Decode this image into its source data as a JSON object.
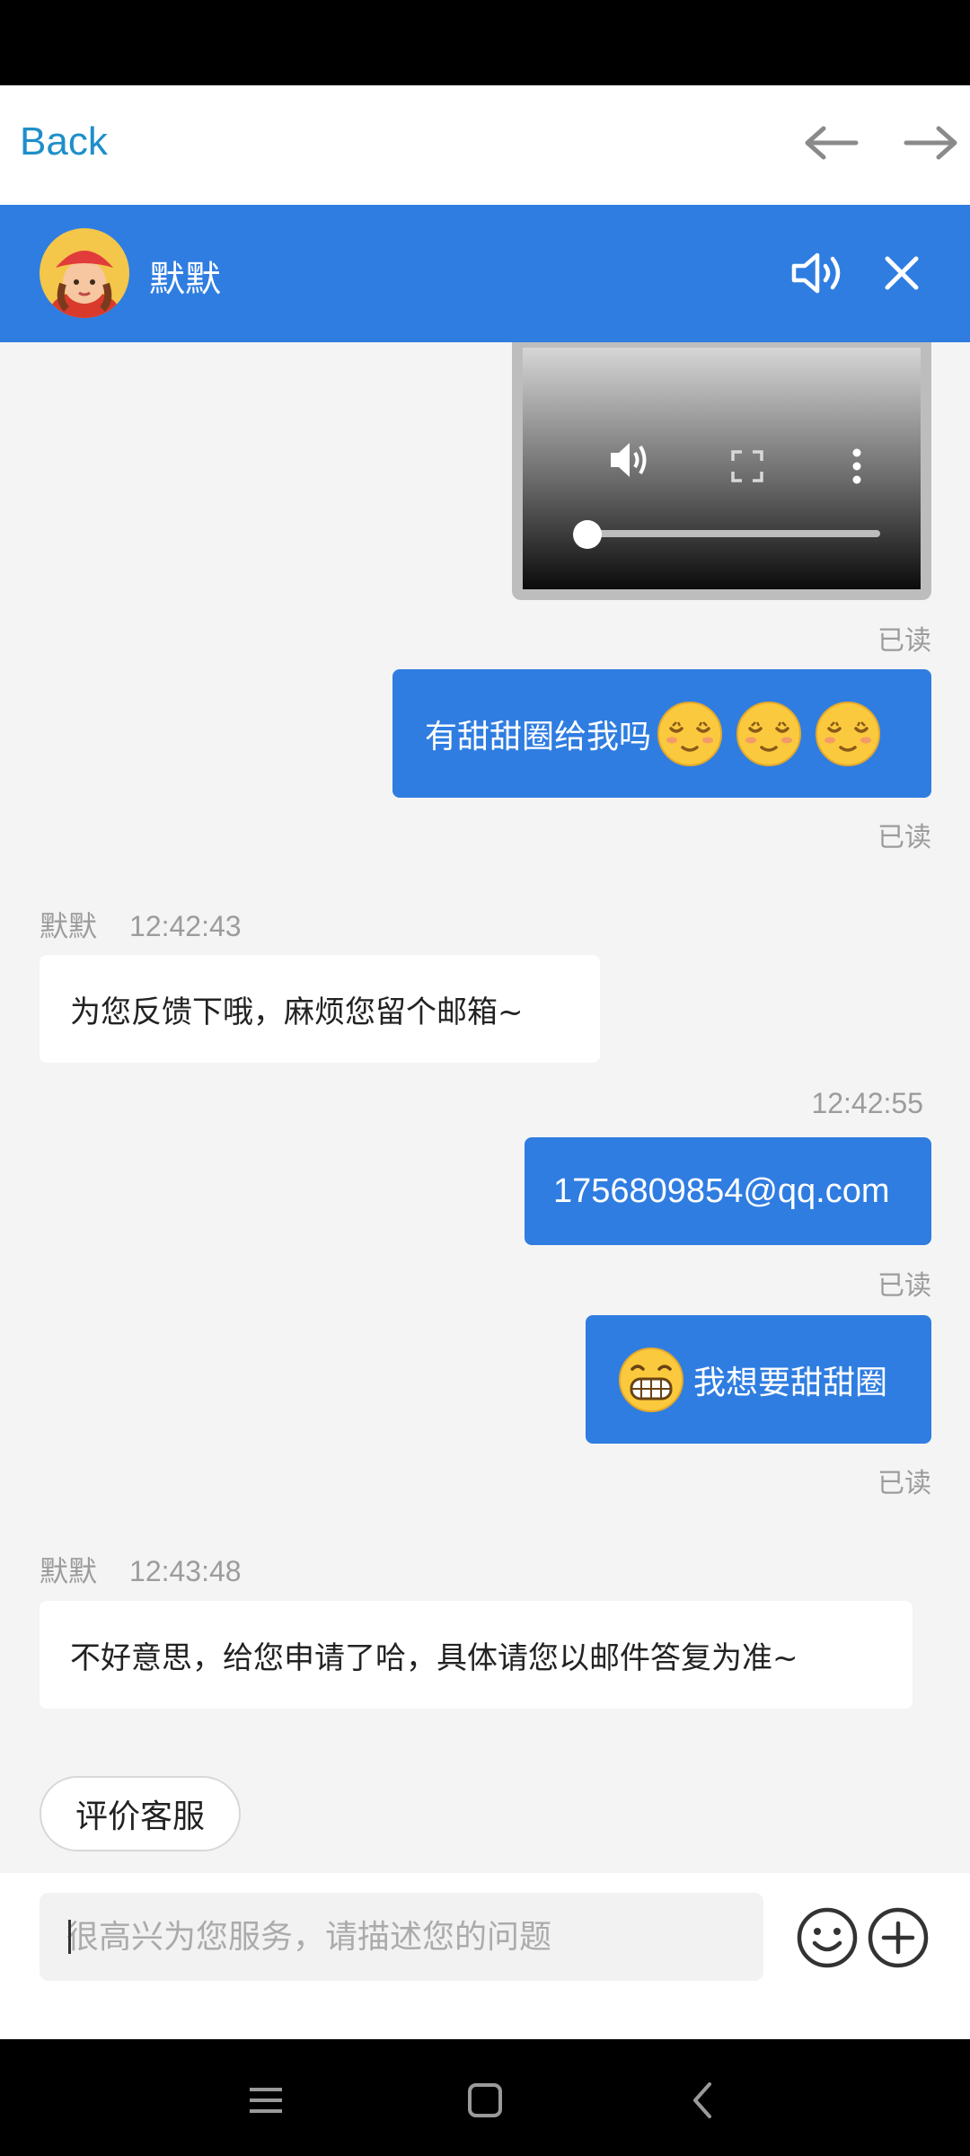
{
  "topnav": {
    "back_label": "Back"
  },
  "header": {
    "agent_name": "默默"
  },
  "messages": [
    {
      "id": "m1",
      "read": "已读"
    },
    {
      "id": "m2",
      "text": "有甜甜圈给我吗",
      "read": "已读"
    },
    {
      "id": "m3",
      "sender": "默默",
      "time": "12:42:43",
      "text": "为您反馈下哦，麻烦您留个邮箱~"
    },
    {
      "id": "m4",
      "time": "12:42:55",
      "text": "1756809854@qq.com",
      "read": "已读"
    },
    {
      "id": "m5",
      "text": "我想要甜甜圈",
      "read": "已读"
    },
    {
      "id": "m6",
      "sender": "默默",
      "time": "12:43:48",
      "text": "不好意思，给您申请了哈，具体请您以邮件答复为准~"
    }
  ],
  "rate_button": "评价客服",
  "input": {
    "placeholder": "很高兴为您服务，请描述您的问题"
  },
  "icons": {
    "nav": [
      "back-arrow-icon",
      "forward-arrow-icon"
    ],
    "header": [
      "avatar",
      "speaker-icon",
      "close-icon"
    ],
    "video": [
      "volume-icon",
      "fullscreen-icon",
      "more-icon"
    ],
    "emoji": [
      "relieved-emoji",
      "grin-emoji"
    ],
    "input": [
      "smile-icon",
      "plus-icon"
    ],
    "system": [
      "menu-icon",
      "home-icon",
      "back-icon"
    ]
  },
  "colors": {
    "accent": "#2f7de1",
    "link": "#1e8fc9",
    "background": "#f4f4f4"
  }
}
